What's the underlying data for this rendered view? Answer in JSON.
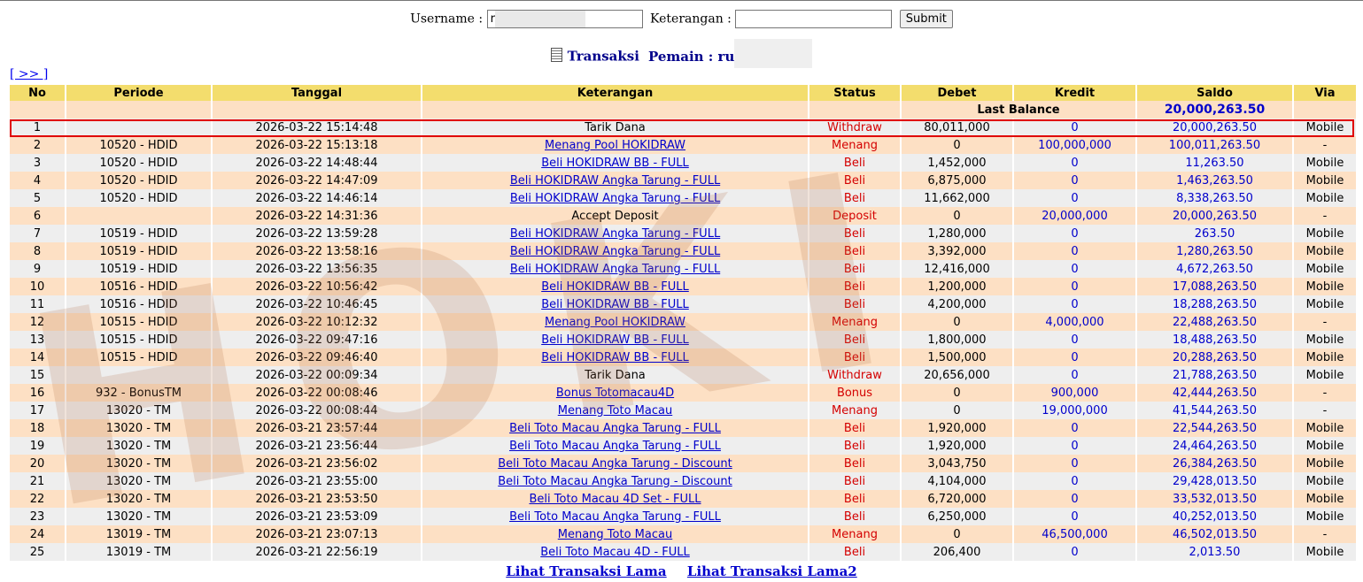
{
  "form": {
    "username_label": "Username :",
    "username_value": "r",
    "keterangan_label": "Keterangan :",
    "keterangan_value": "",
    "submit_label": "Submit"
  },
  "title": {
    "transaksi": "Transaksi",
    "pemain_label": "Pemain : ru"
  },
  "next_link": "[ >> ]",
  "table": {
    "headers": [
      "No",
      "Periode",
      "Tanggal",
      "Keterangan",
      "Status",
      "Debet",
      "Kredit",
      "Saldo",
      "Via"
    ],
    "last_balance_label": "Last Balance",
    "last_balance_value": "20,000,263.50",
    "rows": [
      {
        "no": "1",
        "periode": "",
        "tanggal": "2026-03-22 15:14:48",
        "keterangan": "Tarik Dana",
        "link": false,
        "status": "Withdraw",
        "debet": "80,011,000",
        "kredit": "0",
        "saldo": "20,000,263.50",
        "via": "Mobile"
      },
      {
        "no": "2",
        "periode": "10520 - HDID",
        "tanggal": "2026-03-22 15:13:18",
        "keterangan": "Menang Pool HOKIDRAW",
        "link": true,
        "status": "Menang",
        "debet": "0",
        "kredit": "100,000,000",
        "saldo": "100,011,263.50",
        "via": "-"
      },
      {
        "no": "3",
        "periode": "10520 - HDID",
        "tanggal": "2026-03-22 14:48:44",
        "keterangan": "Beli HOKIDRAW BB - FULL",
        "link": true,
        "status": "Beli",
        "debet": "1,452,000",
        "kredit": "0",
        "saldo": "11,263.50",
        "via": "Mobile"
      },
      {
        "no": "4",
        "periode": "10520 - HDID",
        "tanggal": "2026-03-22 14:47:09",
        "keterangan": "Beli HOKIDRAW Angka Tarung - FULL",
        "link": true,
        "status": "Beli",
        "debet": "6,875,000",
        "kredit": "0",
        "saldo": "1,463,263.50",
        "via": "Mobile"
      },
      {
        "no": "5",
        "periode": "10520 - HDID",
        "tanggal": "2026-03-22 14:46:14",
        "keterangan": "Beli HOKIDRAW Angka Tarung - FULL",
        "link": true,
        "status": "Beli",
        "debet": "11,662,000",
        "kredit": "0",
        "saldo": "8,338,263.50",
        "via": "Mobile"
      },
      {
        "no": "6",
        "periode": "",
        "tanggal": "2026-03-22 14:31:36",
        "keterangan": "Accept Deposit",
        "link": false,
        "status": "Deposit",
        "debet": "0",
        "kredit": "20,000,000",
        "saldo": "20,000,263.50",
        "via": "-"
      },
      {
        "no": "7",
        "periode": "10519 - HDID",
        "tanggal": "2026-03-22 13:59:28",
        "keterangan": "Beli HOKIDRAW Angka Tarung - FULL",
        "link": true,
        "status": "Beli",
        "debet": "1,280,000",
        "kredit": "0",
        "saldo": "263.50",
        "via": "Mobile"
      },
      {
        "no": "8",
        "periode": "10519 - HDID",
        "tanggal": "2026-03-22 13:58:16",
        "keterangan": "Beli HOKIDRAW Angka Tarung - FULL",
        "link": true,
        "status": "Beli",
        "debet": "3,392,000",
        "kredit": "0",
        "saldo": "1,280,263.50",
        "via": "Mobile"
      },
      {
        "no": "9",
        "periode": "10519 - HDID",
        "tanggal": "2026-03-22 13:56:35",
        "keterangan": "Beli HOKIDRAW Angka Tarung - FULL",
        "link": true,
        "status": "Beli",
        "debet": "12,416,000",
        "kredit": "0",
        "saldo": "4,672,263.50",
        "via": "Mobile"
      },
      {
        "no": "10",
        "periode": "10516 - HDID",
        "tanggal": "2026-03-22 10:56:42",
        "keterangan": "Beli HOKIDRAW BB - FULL",
        "link": true,
        "status": "Beli",
        "debet": "1,200,000",
        "kredit": "0",
        "saldo": "17,088,263.50",
        "via": "Mobile"
      },
      {
        "no": "11",
        "periode": "10516 - HDID",
        "tanggal": "2026-03-22 10:46:45",
        "keterangan": "Beli HOKIDRAW BB - FULL",
        "link": true,
        "status": "Beli",
        "debet": "4,200,000",
        "kredit": "0",
        "saldo": "18,288,263.50",
        "via": "Mobile"
      },
      {
        "no": "12",
        "periode": "10515 - HDID",
        "tanggal": "2026-03-22 10:12:32",
        "keterangan": "Menang Pool HOKIDRAW",
        "link": true,
        "status": "Menang",
        "debet": "0",
        "kredit": "4,000,000",
        "saldo": "22,488,263.50",
        "via": "-"
      },
      {
        "no": "13",
        "periode": "10515 - HDID",
        "tanggal": "2026-03-22 09:47:16",
        "keterangan": "Beli HOKIDRAW BB - FULL",
        "link": true,
        "status": "Beli",
        "debet": "1,800,000",
        "kredit": "0",
        "saldo": "18,488,263.50",
        "via": "Mobile"
      },
      {
        "no": "14",
        "periode": "10515 - HDID",
        "tanggal": "2026-03-22 09:46:40",
        "keterangan": "Beli HOKIDRAW BB - FULL",
        "link": true,
        "status": "Beli",
        "debet": "1,500,000",
        "kredit": "0",
        "saldo": "20,288,263.50",
        "via": "Mobile"
      },
      {
        "no": "15",
        "periode": "",
        "tanggal": "2026-03-22 00:09:34",
        "keterangan": "Tarik Dana",
        "link": false,
        "status": "Withdraw",
        "debet": "20,656,000",
        "kredit": "0",
        "saldo": "21,788,263.50",
        "via": "Mobile"
      },
      {
        "no": "16",
        "periode": "932 - BonusTM",
        "tanggal": "2026-03-22 00:08:46",
        "keterangan": "Bonus Totomacau4D",
        "link": true,
        "status": "Bonus",
        "debet": "0",
        "kredit": "900,000",
        "saldo": "42,444,263.50",
        "via": "-"
      },
      {
        "no": "17",
        "periode": "13020 - TM",
        "tanggal": "2026-03-22 00:08:44",
        "keterangan": "Menang Toto Macau",
        "link": true,
        "status": "Menang",
        "debet": "0",
        "kredit": "19,000,000",
        "saldo": "41,544,263.50",
        "via": "-"
      },
      {
        "no": "18",
        "periode": "13020 - TM",
        "tanggal": "2026-03-21 23:57:44",
        "keterangan": "Beli Toto Macau Angka Tarung - FULL",
        "link": true,
        "status": "Beli",
        "debet": "1,920,000",
        "kredit": "0",
        "saldo": "22,544,263.50",
        "via": "Mobile"
      },
      {
        "no": "19",
        "periode": "13020 - TM",
        "tanggal": "2026-03-21 23:56:44",
        "keterangan": "Beli Toto Macau Angka Tarung - FULL",
        "link": true,
        "status": "Beli",
        "debet": "1,920,000",
        "kredit": "0",
        "saldo": "24,464,263.50",
        "via": "Mobile"
      },
      {
        "no": "20",
        "periode": "13020 - TM",
        "tanggal": "2026-03-21 23:56:02",
        "keterangan": "Beli Toto Macau Angka Tarung - Discount",
        "link": true,
        "status": "Beli",
        "debet": "3,043,750",
        "kredit": "0",
        "saldo": "26,384,263.50",
        "via": "Mobile"
      },
      {
        "no": "21",
        "periode": "13020 - TM",
        "tanggal": "2026-03-21 23:55:00",
        "keterangan": "Beli Toto Macau Angka Tarung - Discount",
        "link": true,
        "status": "Beli",
        "debet": "4,104,000",
        "kredit": "0",
        "saldo": "29,428,013.50",
        "via": "Mobile"
      },
      {
        "no": "22",
        "periode": "13020 - TM",
        "tanggal": "2026-03-21 23:53:50",
        "keterangan": "Beli Toto Macau 4D Set - FULL",
        "link": true,
        "status": "Beli",
        "debet": "6,720,000",
        "kredit": "0",
        "saldo": "33,532,013.50",
        "via": "Mobile"
      },
      {
        "no": "23",
        "periode": "13020 - TM",
        "tanggal": "2026-03-21 23:53:09",
        "keterangan": "Beli Toto Macau Angka Tarung - FULL",
        "link": true,
        "status": "Beli",
        "debet": "6,250,000",
        "kredit": "0",
        "saldo": "40,252,013.50",
        "via": "Mobile"
      },
      {
        "no": "24",
        "periode": "13019 - TM",
        "tanggal": "2026-03-21 23:07:13",
        "keterangan": "Menang Toto Macau",
        "link": true,
        "status": "Menang",
        "debet": "0",
        "kredit": "46,500,000",
        "saldo": "46,502,013.50",
        "via": "-"
      },
      {
        "no": "25",
        "periode": "13019 - TM",
        "tanggal": "2026-03-21 22:56:19",
        "keterangan": "Beli Toto Macau 4D - FULL",
        "link": true,
        "status": "Beli",
        "debet": "206,400",
        "kredit": "0",
        "saldo": "2,013.50",
        "via": "Mobile"
      }
    ]
  },
  "footer": {
    "link1": "Lihat Transaksi Lama",
    "link2": "Lihat Transaksi Lama2"
  },
  "watermark_text": "HOKI",
  "colors": {
    "header_bg": "#f3dd6d",
    "row_odd": "#eeeeee",
    "row_even": "#fde0c4",
    "status_red": "#d40000",
    "link_blue": "#0000cc",
    "highlight": "#e00000"
  }
}
